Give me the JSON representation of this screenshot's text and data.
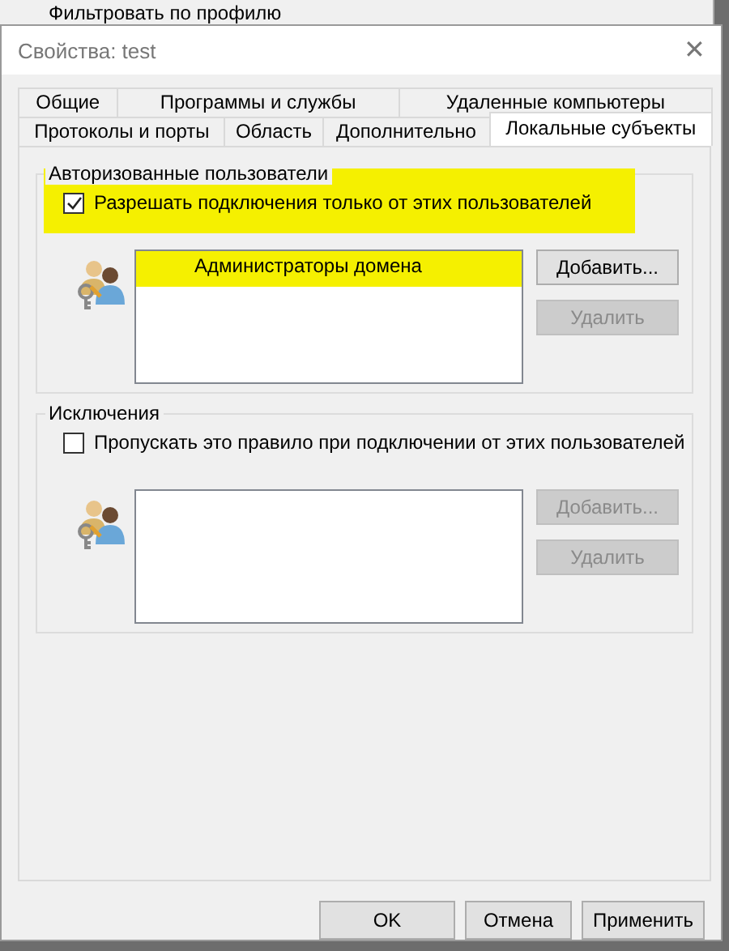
{
  "background_menu": {
    "item": "Фильтровать по профилю"
  },
  "window": {
    "title": "Свойства: test",
    "close": "✕"
  },
  "tab_rows": [
    {
      "tabs": [
        {
          "label": "Общие",
          "selected": false
        },
        {
          "label": "Программы и службы",
          "selected": false
        },
        {
          "label": "Удаленные компьютеры",
          "selected": false
        }
      ]
    },
    {
      "tabs": [
        {
          "label": "Протоколы и порты",
          "selected": false
        },
        {
          "label": "Область",
          "selected": false
        },
        {
          "label": "Дополнительно",
          "selected": false
        },
        {
          "label": "Локальные субъекты",
          "selected": true
        }
      ]
    }
  ],
  "groups": [
    {
      "title": "Авторизованные пользователи",
      "checkbox": {
        "label": "Разрешать подключения только от этих пользователей",
        "checked": true,
        "highlighted": true
      },
      "list": {
        "items": [
          {
            "label": "Администраторы домена",
            "highlighted": true
          }
        ]
      },
      "buttons": [
        {
          "label": "Добавить...",
          "disabled": false
        },
        {
          "label": "Удалить",
          "disabled": true
        }
      ]
    },
    {
      "title": "Исключения",
      "checkbox": {
        "label": "Пропускать это правило при подключении от этих пользователей",
        "checked": false,
        "highlighted": false
      },
      "buttons": [
        {
          "label": "Добавить...",
          "disabled": true
        },
        {
          "label": "Удалить",
          "disabled": true
        }
      ]
    }
  ],
  "buttons": [
    "OK",
    "Отмена",
    "Применить"
  ]
}
